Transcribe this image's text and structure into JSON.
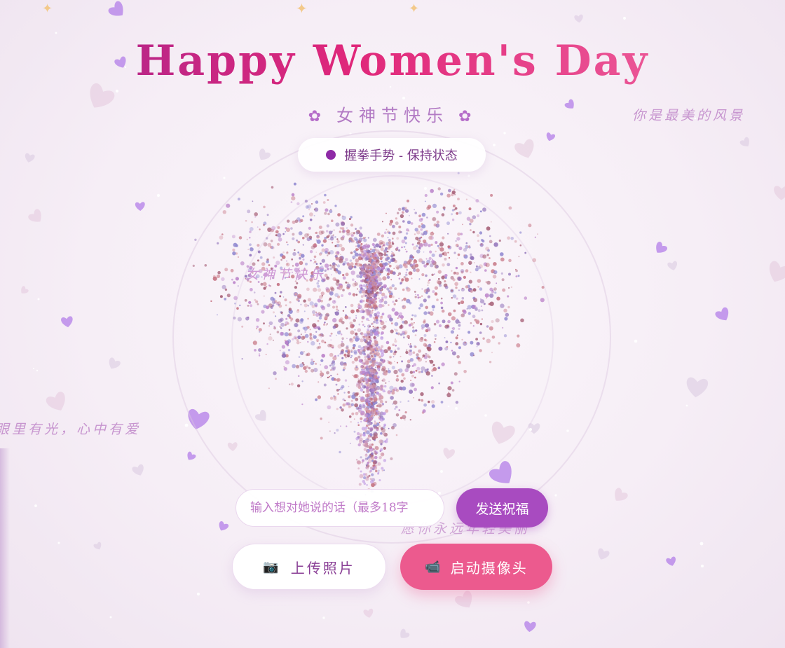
{
  "header": {
    "title": "Happy Women's Day",
    "subtitle": "女神节快乐",
    "subtitle_icon": "flower-icon"
  },
  "status": {
    "text": "握拳手势 - 保持状态",
    "dot_color": "#8e2aa6"
  },
  "floating_texts": [
    "你是最美的风景",
    "女神节快乐",
    "眼里有光，心中有爱",
    "愿你永远年轻美丽"
  ],
  "message": {
    "placeholder": "输入想对她说的话（最多18字",
    "send_label": "发送祝福"
  },
  "actions": {
    "upload_label": "上传照片",
    "upload_icon": "camera-icon",
    "camera_label": "启动摄像头",
    "camera_icon": "video-camera-icon"
  },
  "colors": {
    "title_gradient": [
      "#a4268f",
      "#e0277a",
      "#f06aa2"
    ],
    "send_button": "#a84bc0",
    "camera_button": "#ec5a8e",
    "petal_purple": "#b37ee8",
    "particle_pink": "#c4707f",
    "particle_purple": "#9088d0"
  }
}
